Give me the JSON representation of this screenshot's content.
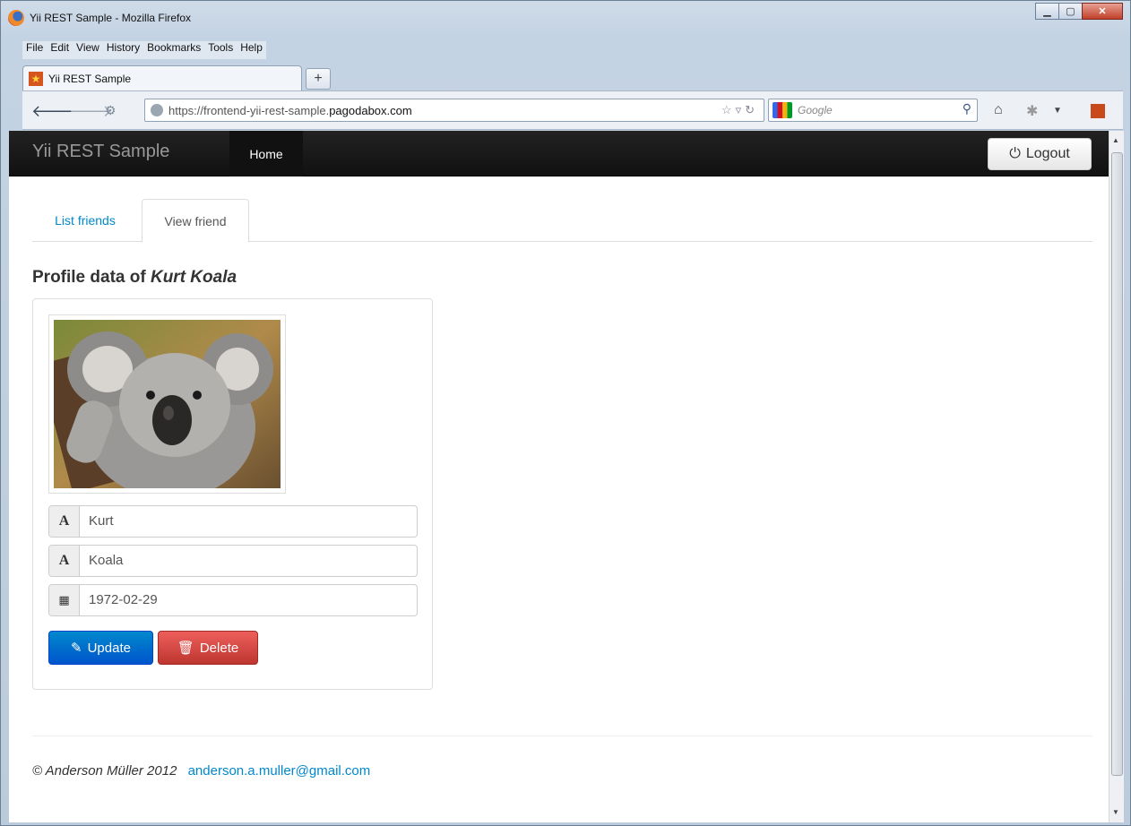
{
  "window": {
    "title": "Yii REST Sample - Mozilla Firefox"
  },
  "menubar": [
    "File",
    "Edit",
    "View",
    "History",
    "Bookmarks",
    "Tools",
    "Help"
  ],
  "browser_tab": {
    "title": "Yii REST Sample"
  },
  "address_bar": {
    "url_prefix": "https://frontend-yii-rest-sample.",
    "url_domain": "pagodabox.com"
  },
  "search_bar": {
    "placeholder": "Google"
  },
  "site": {
    "brand": "Yii REST Sample",
    "nav_home": "Home",
    "logout_label": "Logout"
  },
  "tabs": [
    {
      "label": "List friends",
      "active": false
    },
    {
      "label": "View friend",
      "active": true
    }
  ],
  "profile": {
    "heading_prefix": "Profile data of ",
    "name": "Kurt Koala",
    "first_name": "Kurt",
    "last_name": "Koala",
    "birthdate": "1972-02-29",
    "update_label": "Update",
    "delete_label": "Delete"
  },
  "footer": {
    "copyright": "© Anderson Müller 2012",
    "email": "anderson.a.muller@gmail.com"
  },
  "colors": {
    "link": "#0088cc",
    "update": "#0055cc",
    "delete": "#bd362f",
    "navbar": "#1b1b1b"
  }
}
